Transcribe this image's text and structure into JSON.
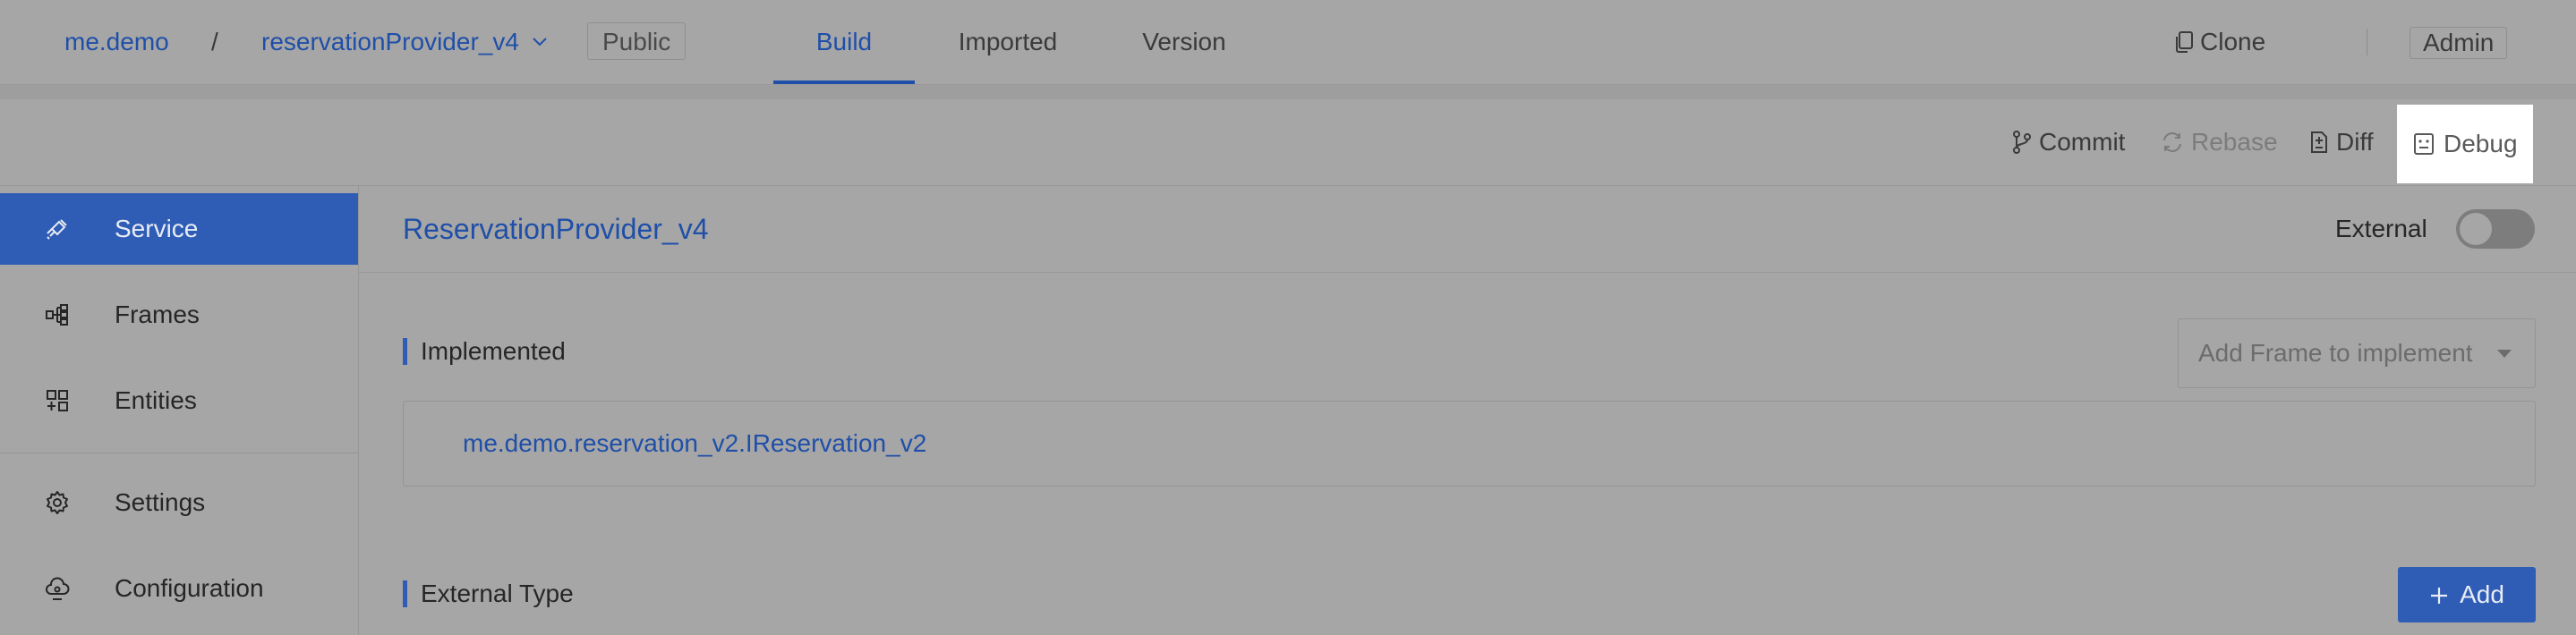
{
  "header": {
    "org": "me.demo",
    "separator": "/",
    "project": "reservationProvider_v4",
    "visibility": "Public",
    "tabs": [
      {
        "label": "Build",
        "active": true
      },
      {
        "label": "Imported",
        "active": false
      },
      {
        "label": "Version",
        "active": false
      }
    ],
    "clone_label": "Clone",
    "user_label": "Admin"
  },
  "toolbar": {
    "commit_label": "Commit",
    "rebase_label": "Rebase",
    "diff_label": "Diff",
    "debug_label": "Debug"
  },
  "sidebar": {
    "items": [
      {
        "label": "Service",
        "icon": "plug-icon",
        "active": true
      },
      {
        "label": "Frames",
        "icon": "frames-icon",
        "active": false
      },
      {
        "label": "Entities",
        "icon": "entities-icon",
        "active": false
      },
      {
        "label": "Settings",
        "icon": "gear-icon",
        "active": false
      },
      {
        "label": "Configuration",
        "icon": "cloud-config-icon",
        "active": false
      }
    ]
  },
  "main": {
    "service_name": "ReservationProvider_v4",
    "external_label": "External",
    "external_enabled": false,
    "implemented_title": "Implemented",
    "add_frame_placeholder": "Add Frame to implement",
    "implemented_items": [
      "me.demo.reservation_v2.IReservation_v2"
    ],
    "external_type_title": "External Type",
    "add_label": "Add"
  },
  "colors": {
    "accent": "#2f5db6",
    "link": "#1f4fa8",
    "overlay_bg": "#a6a6a6"
  }
}
